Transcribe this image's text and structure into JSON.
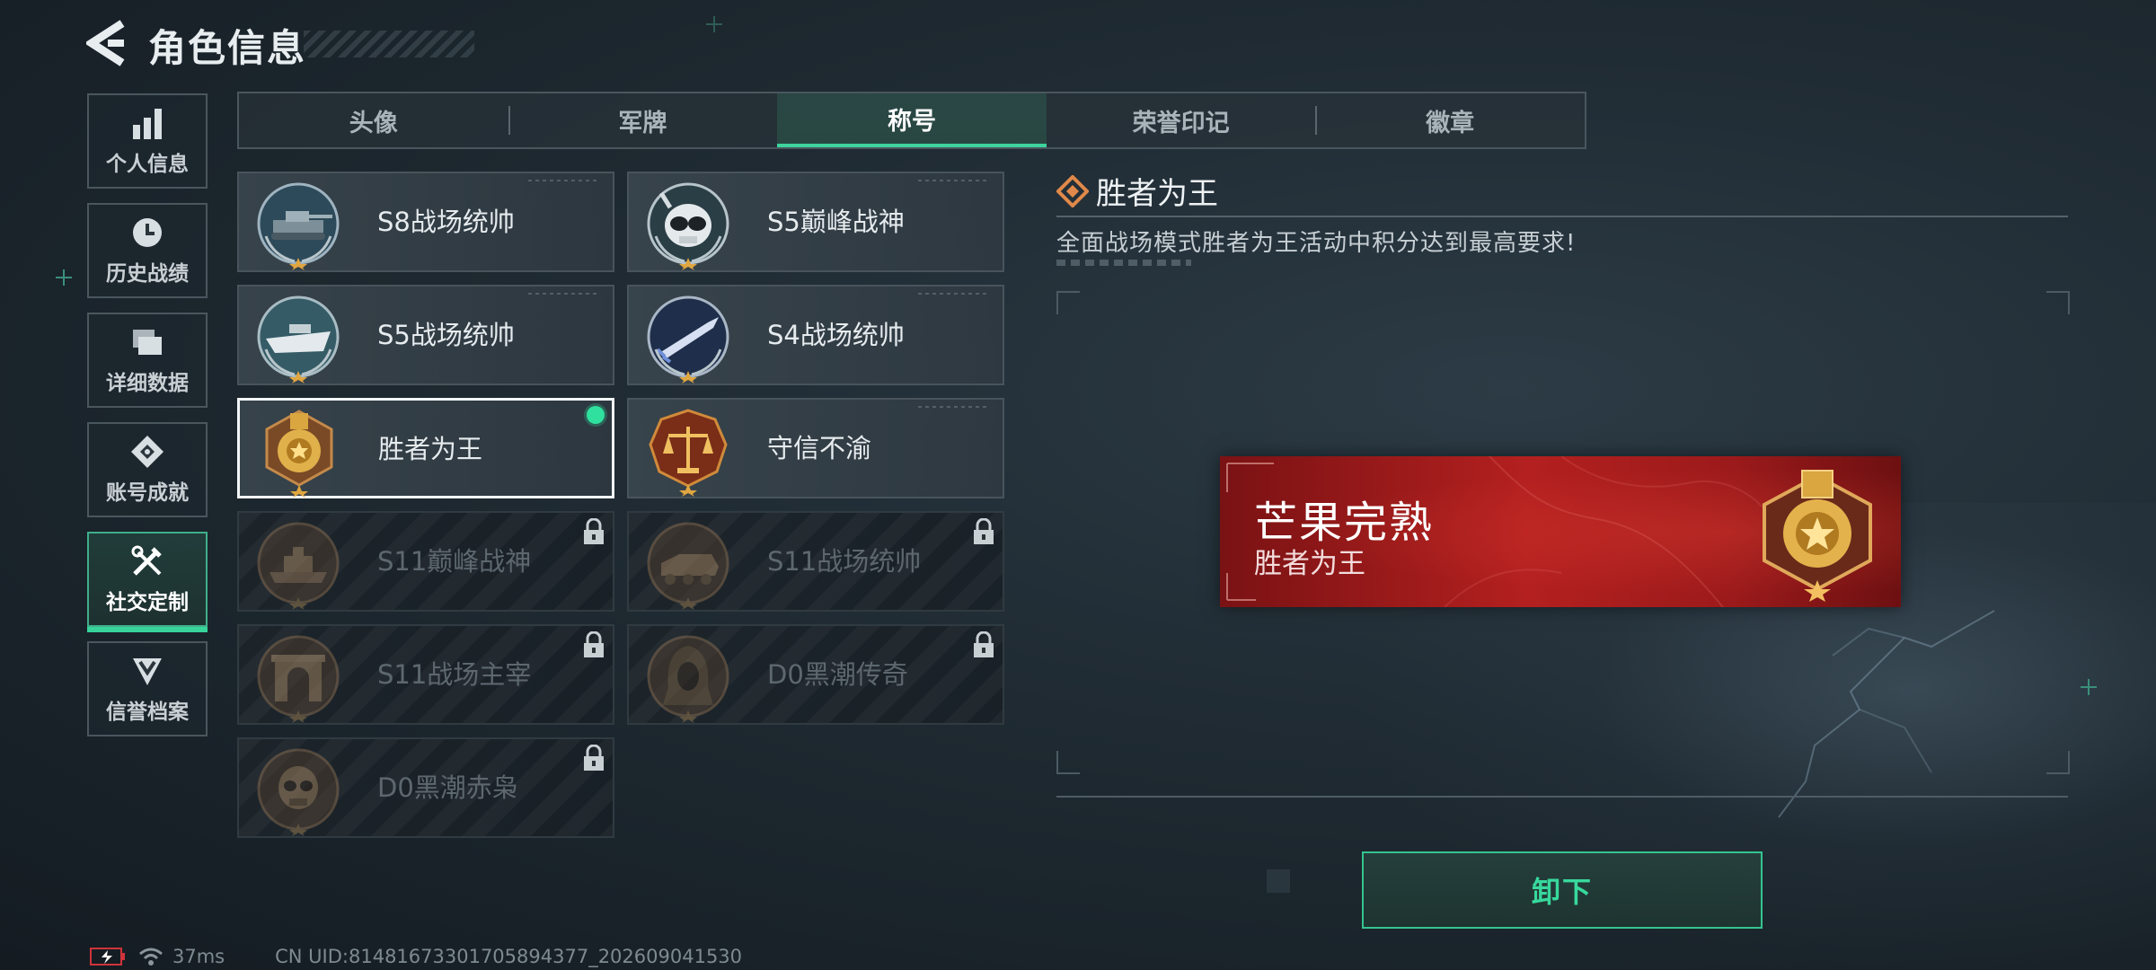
{
  "header": {
    "title": "角色信息"
  },
  "side_nav": [
    {
      "label": "个人信息",
      "icon": "bar-chart-icon"
    },
    {
      "label": "历史战绩",
      "icon": "clock-icon"
    },
    {
      "label": "详细数据",
      "icon": "folders-icon"
    },
    {
      "label": "账号成就",
      "icon": "achievement-icon"
    },
    {
      "label": "社交定制",
      "icon": "wrench-tools-icon",
      "active": true
    },
    {
      "label": "信誉档案",
      "icon": "shield-chevron-icon"
    }
  ],
  "tabs": [
    {
      "label": "头像"
    },
    {
      "label": "军牌"
    },
    {
      "label": "称号",
      "active": true
    },
    {
      "label": "荣誉印记"
    },
    {
      "label": "徽章"
    }
  ],
  "titles": [
    {
      "name": "S8战场统帅",
      "emblem": "tank-emblem-icon",
      "locked": false
    },
    {
      "name": "S5巅峰战神",
      "emblem": "skull-diver-emblem-icon",
      "locked": false
    },
    {
      "name": "S5战场统帅",
      "emblem": "boat-emblem-icon",
      "locked": false
    },
    {
      "name": "S4战场统帅",
      "emblem": "missile-emblem-icon",
      "locked": false
    },
    {
      "name": "胜者为王",
      "emblem": "gold-medal-emblem-icon",
      "locked": false,
      "selected": true,
      "equipped": true
    },
    {
      "name": "守信不渝",
      "emblem": "scales-emblem-icon",
      "locked": false
    },
    {
      "name": "S11巅峰战神",
      "emblem": "hovercraft-emblem-icon",
      "locked": true
    },
    {
      "name": "S11战场统帅",
      "emblem": "apc-emblem-icon",
      "locked": true
    },
    {
      "name": "S11战场主宰",
      "emblem": "arch-emblem-icon",
      "locked": true
    },
    {
      "name": "D0黑潮传奇",
      "emblem": "hooded-figure-emblem-icon",
      "locked": true
    },
    {
      "name": "D0黑潮赤枭",
      "emblem": "skull-mask-emblem-icon",
      "locked": true
    }
  ],
  "detail": {
    "title": "胜者为王",
    "description": "全面战场模式胜者为王活动中积分达到最高要求!"
  },
  "nameplate": {
    "player_name": "芒果完熟",
    "title": "胜者为王",
    "emblem": "gold-medal-emblem-icon"
  },
  "actions": {
    "unequip_label": "卸下"
  },
  "status": {
    "ping": "37ms",
    "uid": "CN UID:81481673301705894377_202609041530"
  },
  "colors": {
    "accent_green": "#37d39b",
    "plate_red": "#b3201f",
    "gold": "#d9a640",
    "background": "#1f2a32"
  }
}
